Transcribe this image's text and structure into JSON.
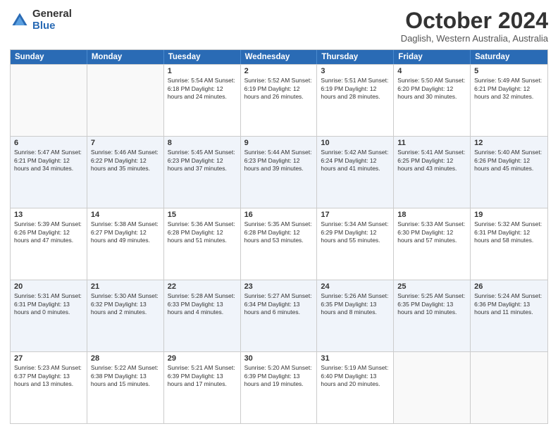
{
  "logo": {
    "general": "General",
    "blue": "Blue"
  },
  "title": {
    "month_year": "October 2024",
    "location": "Daglish, Western Australia, Australia"
  },
  "days_of_week": [
    "Sunday",
    "Monday",
    "Tuesday",
    "Wednesday",
    "Thursday",
    "Friday",
    "Saturday"
  ],
  "weeks": [
    [
      {
        "day": "",
        "info": ""
      },
      {
        "day": "",
        "info": ""
      },
      {
        "day": "1",
        "info": "Sunrise: 5:54 AM\nSunset: 6:18 PM\nDaylight: 12 hours\nand 24 minutes."
      },
      {
        "day": "2",
        "info": "Sunrise: 5:52 AM\nSunset: 6:19 PM\nDaylight: 12 hours\nand 26 minutes."
      },
      {
        "day": "3",
        "info": "Sunrise: 5:51 AM\nSunset: 6:19 PM\nDaylight: 12 hours\nand 28 minutes."
      },
      {
        "day": "4",
        "info": "Sunrise: 5:50 AM\nSunset: 6:20 PM\nDaylight: 12 hours\nand 30 minutes."
      },
      {
        "day": "5",
        "info": "Sunrise: 5:49 AM\nSunset: 6:21 PM\nDaylight: 12 hours\nand 32 minutes."
      }
    ],
    [
      {
        "day": "6",
        "info": "Sunrise: 5:47 AM\nSunset: 6:21 PM\nDaylight: 12 hours\nand 34 minutes."
      },
      {
        "day": "7",
        "info": "Sunrise: 5:46 AM\nSunset: 6:22 PM\nDaylight: 12 hours\nand 35 minutes."
      },
      {
        "day": "8",
        "info": "Sunrise: 5:45 AM\nSunset: 6:23 PM\nDaylight: 12 hours\nand 37 minutes."
      },
      {
        "day": "9",
        "info": "Sunrise: 5:44 AM\nSunset: 6:23 PM\nDaylight: 12 hours\nand 39 minutes."
      },
      {
        "day": "10",
        "info": "Sunrise: 5:42 AM\nSunset: 6:24 PM\nDaylight: 12 hours\nand 41 minutes."
      },
      {
        "day": "11",
        "info": "Sunrise: 5:41 AM\nSunset: 6:25 PM\nDaylight: 12 hours\nand 43 minutes."
      },
      {
        "day": "12",
        "info": "Sunrise: 5:40 AM\nSunset: 6:26 PM\nDaylight: 12 hours\nand 45 minutes."
      }
    ],
    [
      {
        "day": "13",
        "info": "Sunrise: 5:39 AM\nSunset: 6:26 PM\nDaylight: 12 hours\nand 47 minutes."
      },
      {
        "day": "14",
        "info": "Sunrise: 5:38 AM\nSunset: 6:27 PM\nDaylight: 12 hours\nand 49 minutes."
      },
      {
        "day": "15",
        "info": "Sunrise: 5:36 AM\nSunset: 6:28 PM\nDaylight: 12 hours\nand 51 minutes."
      },
      {
        "day": "16",
        "info": "Sunrise: 5:35 AM\nSunset: 6:28 PM\nDaylight: 12 hours\nand 53 minutes."
      },
      {
        "day": "17",
        "info": "Sunrise: 5:34 AM\nSunset: 6:29 PM\nDaylight: 12 hours\nand 55 minutes."
      },
      {
        "day": "18",
        "info": "Sunrise: 5:33 AM\nSunset: 6:30 PM\nDaylight: 12 hours\nand 57 minutes."
      },
      {
        "day": "19",
        "info": "Sunrise: 5:32 AM\nSunset: 6:31 PM\nDaylight: 12 hours\nand 58 minutes."
      }
    ],
    [
      {
        "day": "20",
        "info": "Sunrise: 5:31 AM\nSunset: 6:31 PM\nDaylight: 13 hours\nand 0 minutes."
      },
      {
        "day": "21",
        "info": "Sunrise: 5:30 AM\nSunset: 6:32 PM\nDaylight: 13 hours\nand 2 minutes."
      },
      {
        "day": "22",
        "info": "Sunrise: 5:28 AM\nSunset: 6:33 PM\nDaylight: 13 hours\nand 4 minutes."
      },
      {
        "day": "23",
        "info": "Sunrise: 5:27 AM\nSunset: 6:34 PM\nDaylight: 13 hours\nand 6 minutes."
      },
      {
        "day": "24",
        "info": "Sunrise: 5:26 AM\nSunset: 6:35 PM\nDaylight: 13 hours\nand 8 minutes."
      },
      {
        "day": "25",
        "info": "Sunrise: 5:25 AM\nSunset: 6:35 PM\nDaylight: 13 hours\nand 10 minutes."
      },
      {
        "day": "26",
        "info": "Sunrise: 5:24 AM\nSunset: 6:36 PM\nDaylight: 13 hours\nand 11 minutes."
      }
    ],
    [
      {
        "day": "27",
        "info": "Sunrise: 5:23 AM\nSunset: 6:37 PM\nDaylight: 13 hours\nand 13 minutes."
      },
      {
        "day": "28",
        "info": "Sunrise: 5:22 AM\nSunset: 6:38 PM\nDaylight: 13 hours\nand 15 minutes."
      },
      {
        "day": "29",
        "info": "Sunrise: 5:21 AM\nSunset: 6:39 PM\nDaylight: 13 hours\nand 17 minutes."
      },
      {
        "day": "30",
        "info": "Sunrise: 5:20 AM\nSunset: 6:39 PM\nDaylight: 13 hours\nand 19 minutes."
      },
      {
        "day": "31",
        "info": "Sunrise: 5:19 AM\nSunset: 6:40 PM\nDaylight: 13 hours\nand 20 minutes."
      },
      {
        "day": "",
        "info": ""
      },
      {
        "day": "",
        "info": ""
      }
    ]
  ]
}
